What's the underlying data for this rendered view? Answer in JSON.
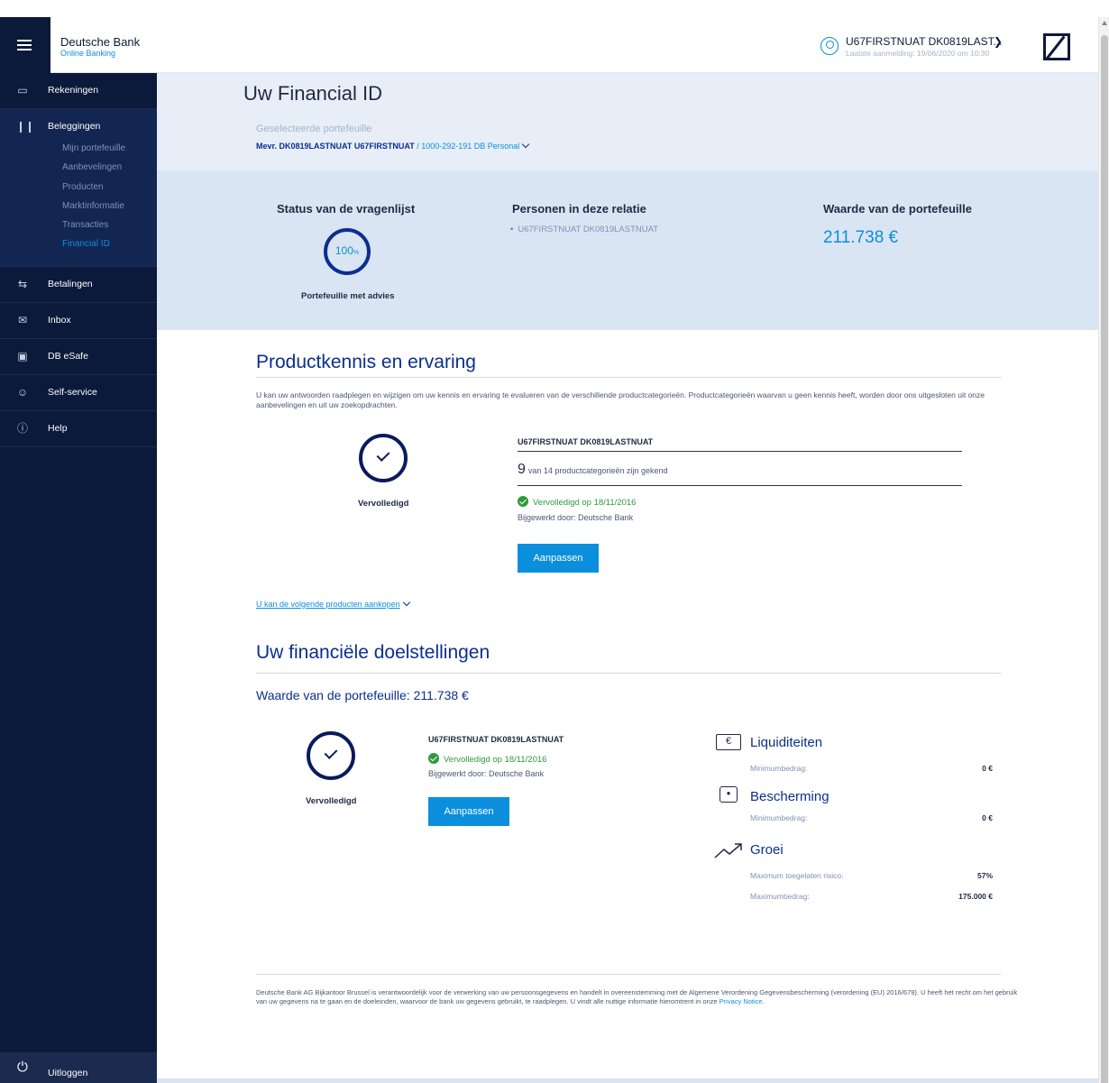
{
  "header": {
    "brand": "Deutsche Bank",
    "brand_sub": "Online Banking",
    "user_name": "U67FIRSTNUAT DK0819LAST...",
    "last_login": "Laatste aanmelding: 19/06/2020 om 10:30",
    "icons": {
      "menu": "hamburger-icon",
      "user": "user-icon",
      "logo": "db-logo"
    }
  },
  "sidebar": {
    "items": [
      {
        "label": "Rekeningen",
        "icon": "card-icon"
      },
      {
        "label": "Beleggingen",
        "icon": "bars-icon"
      },
      {
        "label": "Betalingen",
        "icon": "arrows-icon"
      },
      {
        "label": "Inbox",
        "icon": "mail-icon"
      },
      {
        "label": "DB eSafe",
        "icon": "safe-icon"
      },
      {
        "label": "Self-service",
        "icon": "person-icon"
      },
      {
        "label": "Help",
        "icon": "help-icon"
      }
    ],
    "sub_items": [
      "Mijn portefeuille",
      "Aanbevelingen",
      "Producten",
      "Marktinformatie",
      "Transacties",
      "Financial ID"
    ],
    "active_sub": "Financial ID",
    "logout": "Uitloggen"
  },
  "hero": {
    "title": "Uw Financial ID",
    "selected_label": "Geselecteerde portefeuille",
    "selected_name": "Mevr. DK0819LASTNUAT U67FIRSTNUAT",
    "selected_rest": " / 1000-292-191 DB Personal"
  },
  "status": {
    "questionnaire_heading": "Status van de vragenlijst",
    "percent": "100",
    "percent_unit": "%",
    "advice_label": "Portefeuille met advies",
    "persons_heading": "Personen in deze relatie",
    "person": "U67FIRSTNUAT DK0819LASTNUAT",
    "value_heading": "Waarde van de portefeuille",
    "value": "211.738 €"
  },
  "knowledge": {
    "title": "Productkennis en ervaring",
    "intro": "U kan uw antwoorden raadplegen en wijzigen om uw kennis en ervaring te evalueren van de verschillende productcategorieën. Productcategorieën waarvan u geen kennis heeft, worden door ons uitgesloten uit onze aanbevelingen en uit uw zoekopdrachten.",
    "status_caption": "Vervolledigd",
    "person": "U67FIRSTNUAT DK0819LASTNUAT",
    "count": "9",
    "count_text": "van 14 productcategorieën zijn gekend",
    "completed": "Vervolledigd op 18/11/2016",
    "updated_by": "Bijgewerkt door: Deutsche Bank",
    "button": "Aanpassen",
    "link": "U kan de volgende producten aankopen"
  },
  "goals": {
    "title": "Uw financiële doelstellingen",
    "portfolio_value": "Waarde van de portefeuille: 211.738 €",
    "status_caption": "Vervolledigd",
    "person": "U67FIRSTNUAT DK0819LASTNUAT",
    "completed": "Vervolledigd op 18/11/2016",
    "updated_by": "Bijgewerkt door: Deutsche Bank",
    "button": "Aanpassen",
    "liquidity": {
      "title": "Liquiditeiten",
      "label": "Minimumbedrag:",
      "value": "0 €",
      "icon": "euro-icon"
    },
    "protection": {
      "title": "Bescherming",
      "label": "Minimumbedrag:",
      "value": "0 €",
      "icon": "lock-icon"
    },
    "growth": {
      "title": "Groei",
      "risk_label": "Maximum toegelaten risico:",
      "risk_value": "57%",
      "max_label": "Maximumbedrag:",
      "max_value": "175.000 €",
      "icon": "trend-icon"
    }
  },
  "footer": {
    "text": "Deutsche Bank AG Bijkantoor Brussel is verantwoordelijk voor de verwerking van uw persoonsgegevens en handelt in overeenstemming met de Algemene Verordening Gegevensbescherming (verordening (EU) 2016/679). U heeft het recht om het gebruik van uw gegevens na te gaan en de doeleinden, waarvoor de bank uw gegevens gebruikt, te raadplegen. U vindt alle nuttige informatie hieromtrent in onze ",
    "privacy_link": "Privacy Notice",
    "end": "."
  }
}
